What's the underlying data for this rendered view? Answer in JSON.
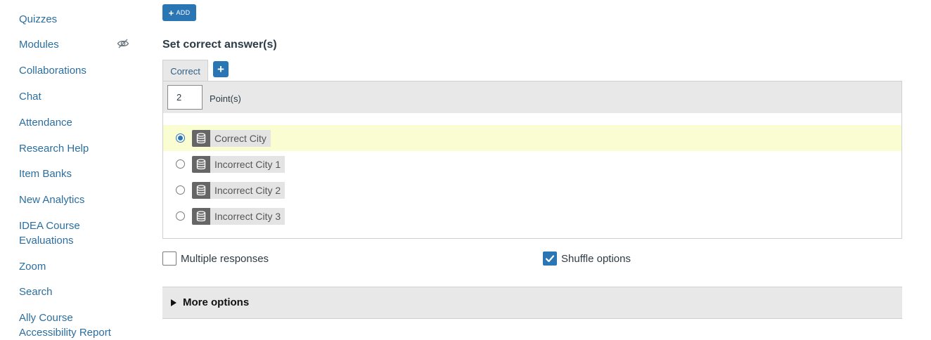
{
  "sidebar": {
    "items": [
      {
        "label": "Quizzes"
      },
      {
        "label": "Modules",
        "hidden_icon": "eye-slash-icon"
      },
      {
        "label": "Collaborations"
      },
      {
        "label": "Chat"
      },
      {
        "label": "Attendance"
      },
      {
        "label": "Research Help"
      },
      {
        "label": "Item Banks"
      },
      {
        "label": "New Analytics"
      },
      {
        "label": "IDEA Course Evaluations"
      },
      {
        "label": "Zoom"
      },
      {
        "label": "Search"
      },
      {
        "label": "Ally Course Accessibility Report"
      }
    ]
  },
  "toolbar": {
    "add_label": "ADD",
    "add_icon": "plus-icon"
  },
  "answers": {
    "title": "Set correct answer(s)",
    "tab_label": "Correct",
    "points_value": "2",
    "points_label": "Point(s)",
    "options": [
      {
        "label": "Correct City",
        "selected": true,
        "icon": "database-icon"
      },
      {
        "label": "Incorrect City 1",
        "selected": false,
        "icon": "database-icon"
      },
      {
        "label": "Incorrect City 2",
        "selected": false,
        "icon": "database-icon"
      },
      {
        "label": "Incorrect City 3",
        "selected": false,
        "icon": "database-icon"
      }
    ]
  },
  "settings": {
    "multiple_responses_label": "Multiple responses",
    "multiple_responses_checked": false,
    "shuffle_options_label": "Shuffle options",
    "shuffle_options_checked": true,
    "more_options_label": "More options"
  },
  "colors": {
    "link": "#2b6e9f",
    "accent": "#2a76b5",
    "selected_row": "#fafcd2",
    "panel": "#e8e8e8"
  }
}
